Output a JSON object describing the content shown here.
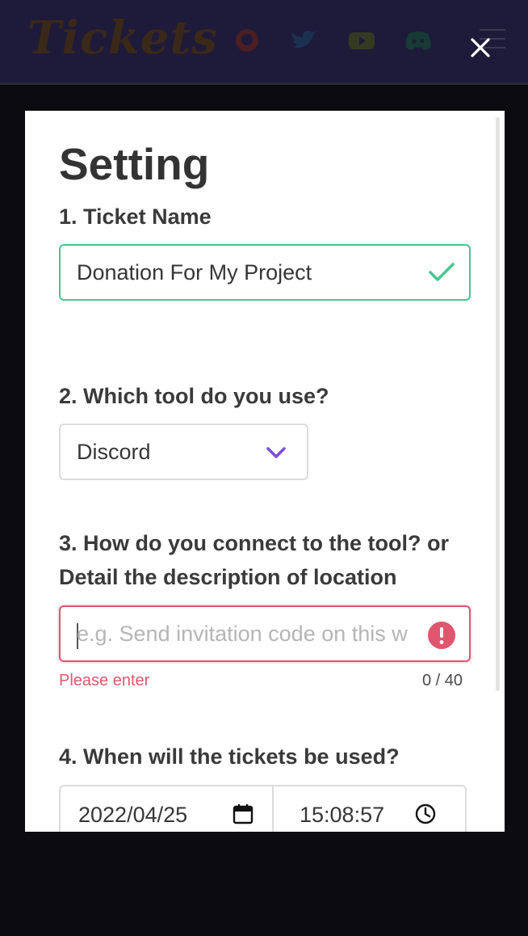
{
  "navbar": {
    "logo": "Tickets",
    "icons": [
      "github-icon",
      "twitter-icon",
      "youtube-icon",
      "discord-icon"
    ]
  },
  "modal": {
    "title": "Setting",
    "ticket_name": {
      "label": "1. Ticket Name",
      "value": "Donation For My Project",
      "status": "valid"
    },
    "tool": {
      "label": "2. Which tool do you use?",
      "selected": "Discord"
    },
    "connection": {
      "label_line1": "3. How do you connect to the tool? or",
      "label_line2": "Detail the description of location",
      "value": "",
      "placeholder": "e.g. Send invitation code on this w",
      "error": "Please enter",
      "counter": "0 / 40"
    },
    "usage": {
      "label": "4. When will the tickets be used?",
      "date": "2022/04/25",
      "time": "15:08:57"
    }
  },
  "colors": {
    "success": "#48c78e",
    "danger": "#e0566f",
    "accent": "#7c4dda"
  }
}
